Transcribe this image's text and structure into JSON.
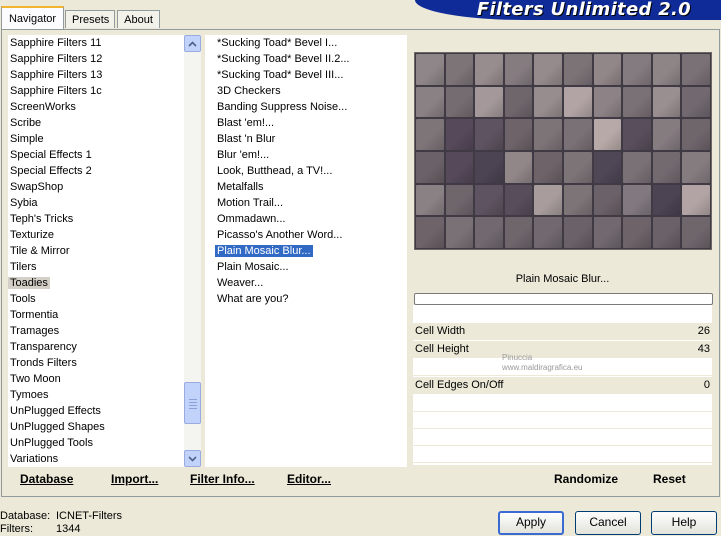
{
  "tabs": [
    {
      "label": "Navigator",
      "active": true
    },
    {
      "label": "Presets",
      "active": false
    },
    {
      "label": "About",
      "active": false
    }
  ],
  "banner": {
    "title": "Filters Unlimited 2.0"
  },
  "categories": {
    "items": [
      "Sapphire Filters 11",
      "Sapphire Filters 12",
      "Sapphire Filters 13",
      "Sapphire Filters 1c",
      "ScreenWorks",
      "Scribe",
      "Simple",
      "Special Effects 1",
      "Special Effects 2",
      "SwapShop",
      "Sybia",
      "Teph's Tricks",
      "Texturize",
      "Tile & Mirror",
      "Tilers",
      "Toadies",
      "Tools",
      "Tormentia",
      "Tramages",
      "Transparency",
      "Tronds Filters",
      "Two Moon",
      "Tymoes",
      "UnPlugged Effects",
      "UnPlugged Shapes",
      "UnPlugged Tools",
      "Variations"
    ],
    "selected": "Toadies"
  },
  "filters": {
    "items": [
      "*Sucking Toad*  Bevel I...",
      "*Sucking Toad*  Bevel II.2...",
      "*Sucking Toad*  Bevel III...",
      "3D Checkers",
      "Banding Suppress Noise...",
      "Blast 'em!...",
      "Blast 'n Blur",
      "Blur 'em!...",
      "Look, Butthead, a TV!...",
      "Metalfalls",
      "Motion Trail...",
      "Ommadawn...",
      "Picasso's Another Word...",
      "Plain Mosaic Blur...",
      "Plain Mosaic...",
      "Weaver...",
      "What are you?"
    ],
    "selected": "Plain Mosaic Blur..."
  },
  "frame_buttons": {
    "database": "Database",
    "import": "Import...",
    "filter_info": "Filter Info...",
    "editor": "Editor...",
    "randomize": "Randomize",
    "reset": "Reset"
  },
  "preview": {
    "filter_name": "Plain Mosaic Blur...",
    "cell_colors": [
      "#8e8688",
      "#7d7478",
      "#988d8e",
      "#857c80",
      "#958b8d",
      "#7c7377",
      "#918688",
      "#847b80",
      "#8e8587",
      "#7a7176",
      "#8a8184",
      "#756c71",
      "#a4989a",
      "#6f666c",
      "#978c8e",
      "#b2a4a4",
      "#8d8386",
      "#7a7176",
      "#998e90",
      "#716870",
      "#7e7579",
      "#55495a",
      "#5e5360",
      "#6d6369",
      "#7d7478",
      "#7a7176",
      "#b7a9a8",
      "#594f5c",
      "#857c80",
      "#6f666c",
      "#6b6168",
      "#55495a",
      "#4c4353",
      "#918688",
      "#6d6369",
      "#7d7478",
      "#4f4656",
      "#7a7176",
      "#736a70",
      "#857c80",
      "#8a8184",
      "#6f666c",
      "#5e5360",
      "#584d5b",
      "#a89c9c",
      "#7d7478",
      "#6b6168",
      "#817880",
      "#4c4353",
      "#b2a4a4",
      "#6d6369",
      "#7a7176",
      "#716870",
      "#6f666c",
      "#716870",
      "#6b6168",
      "#716870",
      "#6d6369",
      "#6b6168",
      "#6f666c"
    ]
  },
  "params": [
    {
      "label": "Cell Width",
      "value": "26"
    },
    {
      "label": "Cell Height",
      "value": "43"
    },
    {
      "label": "Cell Edges On/Off",
      "value": "0"
    }
  ],
  "watermark": {
    "line1": "Pinuccia",
    "line2": "www.maldiragrafica.eu"
  },
  "status": {
    "database_label": "Database:",
    "database_value": "ICNET-Filters",
    "filters_label": "Filters:",
    "filters_value": "1344"
  },
  "buttons": {
    "apply": "Apply",
    "cancel": "Cancel",
    "help": "Help"
  }
}
